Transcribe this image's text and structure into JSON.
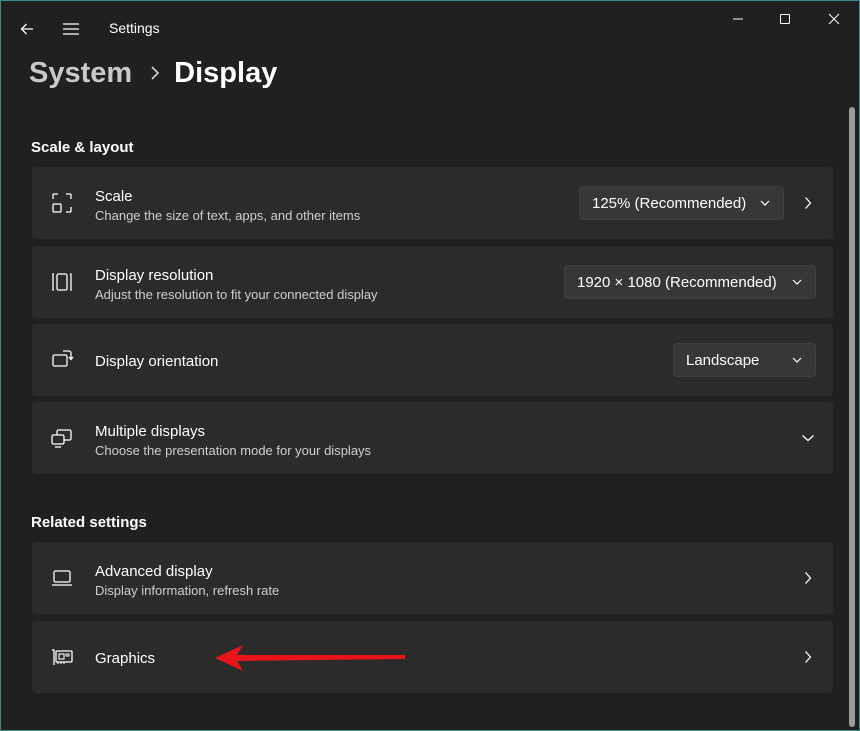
{
  "window": {
    "app_title": "Settings"
  },
  "breadcrumb": {
    "parent": "System",
    "current": "Display"
  },
  "sections": {
    "scale_layout": "Scale & layout",
    "related": "Related settings"
  },
  "scale": {
    "title": "Scale",
    "description": "Change the size of text, apps, and other items",
    "value": "125% (Recommended)"
  },
  "resolution": {
    "title": "Display resolution",
    "description": "Adjust the resolution to fit your connected display",
    "value": "1920 × 1080 (Recommended)"
  },
  "orientation": {
    "title": "Display orientation",
    "value": "Landscape"
  },
  "multiple": {
    "title": "Multiple displays",
    "description": "Choose the presentation mode for your displays"
  },
  "advanced": {
    "title": "Advanced display",
    "description": "Display information, refresh rate"
  },
  "graphics": {
    "title": "Graphics"
  },
  "icons": {
    "back": "back-arrow-icon",
    "menu": "hamburger-icon",
    "minimize": "minimize-icon",
    "maximize": "maximize-icon",
    "close": "close-icon",
    "scale": "scale-icon",
    "resolution": "resolution-icon",
    "orientation": "orientation-icon",
    "multiple": "multiple-displays-icon",
    "advanced": "laptop-icon",
    "graphics": "graphics-card-icon"
  },
  "colors": {
    "background": "#202020",
    "card": "#2b2b2b",
    "annotation_arrow": "#e8141a"
  }
}
